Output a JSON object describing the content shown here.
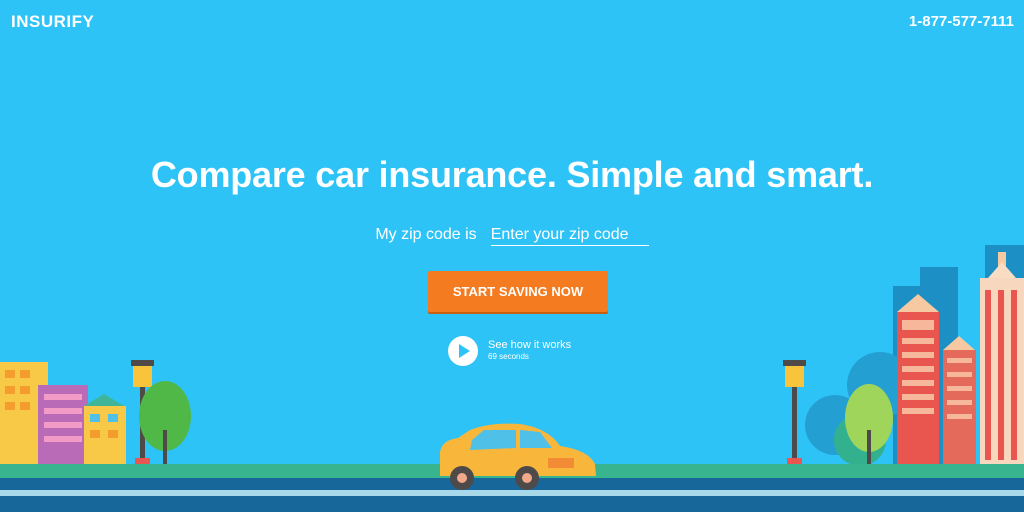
{
  "header": {
    "logo_text": "INSURIFY",
    "phone": "1-877-577-7111"
  },
  "hero": {
    "headline": "Compare car insurance. Simple and smart.",
    "zip_label": "My zip code is",
    "zip_placeholder": "Enter your zip code",
    "cta_label": "START SAVING NOW",
    "video_title": "See how it works",
    "video_duration": "69 seconds"
  },
  "colors": {
    "sky": "#2ec3f7",
    "cta": "#f47b20",
    "road": "#18679a",
    "grass": "#38b58f"
  }
}
